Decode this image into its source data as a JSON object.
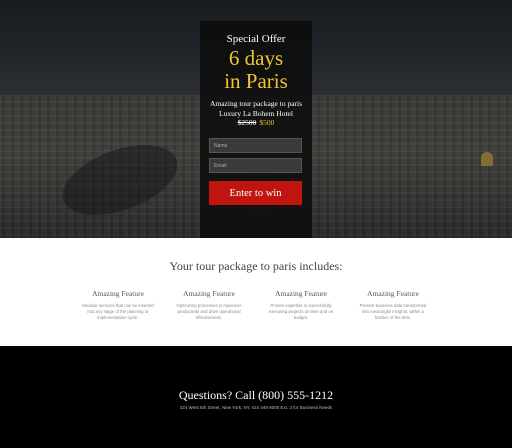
{
  "hero": {
    "kicker": "Special Offer",
    "headline_line1": "6 days",
    "headline_line2": "in Paris",
    "package_line1": "Amazing tour package to paris",
    "package_line2": "Luxury La Bohem Hotel",
    "old_price": "$2500",
    "new_price": "$500",
    "name_placeholder": "Name",
    "email_placeholder": "Email",
    "cta_label": "Enter to win"
  },
  "features": {
    "title": "Your tour package to paris includes:",
    "items": [
      {
        "title": "Amazing Feature",
        "text": "Modular services that can be inserted into any stage of the planning or implementation cycle."
      },
      {
        "title": "Amazing Feature",
        "text": "Optimizing processes to maximize productivity and drive operational effectiveness."
      },
      {
        "title": "Amazing Feature",
        "text": "Proven expertise in successfully executing projects on time and on budget."
      },
      {
        "title": "Amazing Feature",
        "text": "Present business data transformed into meaningful insights, within a fraction of the time."
      }
    ]
  },
  "footer": {
    "phone": "Questions? Call (800) 555-1212",
    "address": "224 West 5th Street, New York, NY, 424 449 8000 Ext. 3 for Business Needs"
  }
}
